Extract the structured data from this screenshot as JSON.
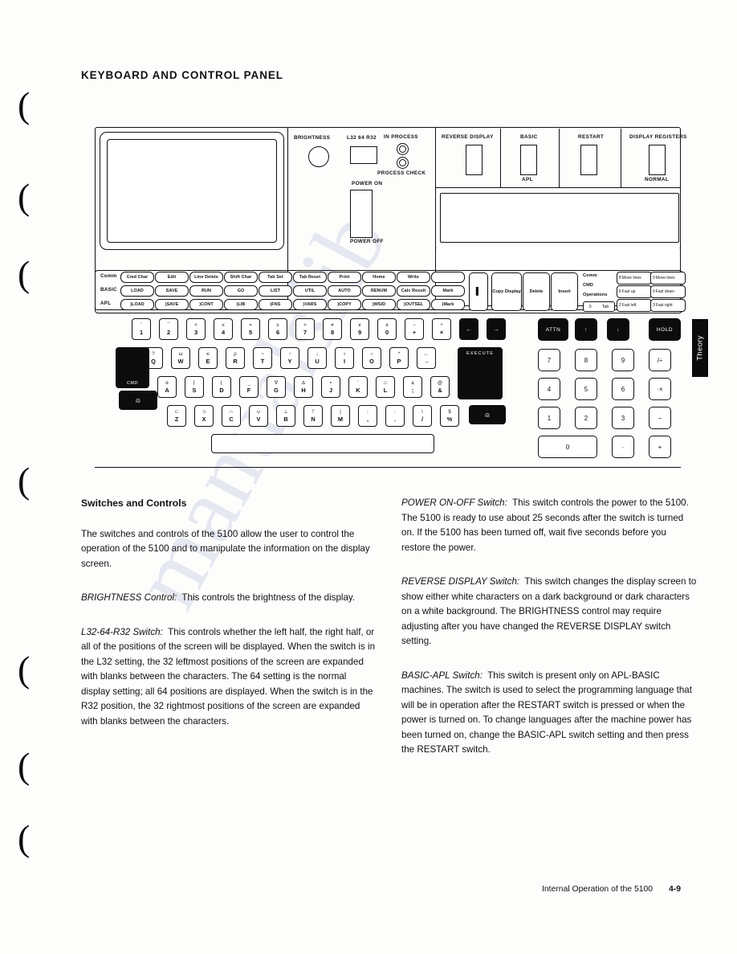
{
  "header": {
    "title": "KEYBOARD AND CONTROL PANEL"
  },
  "tab": {
    "label": "Theory"
  },
  "figure": {
    "control_panel": {
      "brightness_label": "BRIGHTNESS",
      "l32_label": "L32 64 R32",
      "in_process_label": "IN PROCESS",
      "process_check_label": "PROCESS CHECK",
      "power_on_label": "POWER ON",
      "power_off_label": "POWER OFF"
    },
    "switches": [
      {
        "top": "REVERSE DISPLAY",
        "bottom": ""
      },
      {
        "top": "BASIC",
        "bottom": "APL"
      },
      {
        "top": "RESTART",
        "bottom": ""
      },
      {
        "top": "DISPLAY REGISTERS",
        "bottom": "NORMAL"
      }
    ],
    "function_rows": [
      {
        "label": "Comm",
        "keys": [
          "Cmd Char",
          "Edit",
          "Line Delete",
          "Shift Char",
          "Tab Set",
          "Tab Reset",
          "Print",
          "Home",
          "Write",
          ""
        ]
      },
      {
        "label": "BASIC",
        "keys": [
          "LOAD",
          "SAVE",
          "RUN",
          "GO",
          "LIST",
          "UTIL",
          "AUTO",
          "RENUM",
          "Calc Result",
          "Mark"
        ]
      },
      {
        "label": "APL",
        "keys": [
          ")LOAD",
          ")SAVE",
          ")CONT",
          ")LIB",
          ")FNS",
          ")VARS",
          ")COPY",
          ")WSID",
          ")OUTSEL",
          ")Mark"
        ]
      }
    ],
    "edit_keys": [
      "Copy Display",
      "Delete",
      "Insert"
    ],
    "cmd_operations": {
      "title_lines": [
        "Comm",
        "CMD",
        "Operations"
      ],
      "tab_key": {
        "digit": "0",
        "label": "Tab"
      },
      "moves": [
        {
          "digit": "8",
          "label": "Move lines"
        },
        {
          "digit": "9",
          "label": "Move lines"
        },
        {
          "digit": "5",
          "label": "Fast up"
        },
        {
          "digit": "6",
          "label": "Fast down"
        },
        {
          "digit": "2",
          "label": "Fast left"
        },
        {
          "digit": "3",
          "label": "Fast right"
        }
      ]
    },
    "number_row": [
      {
        "upper": "¨",
        "lower": "1"
      },
      {
        "upper": "¯",
        "lower": "2"
      },
      {
        "upper": "<",
        "lower": "3"
      },
      {
        "upper": "≤",
        "lower": "4"
      },
      {
        "upper": "=",
        "lower": "5"
      },
      {
        "upper": "≥",
        "lower": "6"
      },
      {
        "upper": ">",
        "lower": "7"
      },
      {
        "upper": "≠",
        "lower": "8"
      },
      {
        "upper": "∨",
        "lower": "9"
      },
      {
        "upper": "∧",
        "lower": "0"
      },
      {
        "upper": "−",
        "lower": "+"
      },
      {
        "upper": "÷",
        "lower": "×"
      }
    ],
    "q_row": [
      {
        "upper": "?",
        "lower": "Q"
      },
      {
        "upper": "ω",
        "lower": "W"
      },
      {
        "upper": "∊",
        "lower": "E"
      },
      {
        "upper": "ρ",
        "lower": "R"
      },
      {
        "upper": "~",
        "lower": "T"
      },
      {
        "upper": "↑",
        "lower": "Y"
      },
      {
        "upper": "↓",
        "lower": "U"
      },
      {
        "upper": "ι",
        "lower": "I"
      },
      {
        "upper": "○",
        "lower": "O"
      },
      {
        "upper": "*",
        "lower": "P"
      },
      {
        "upper": "←",
        "lower": "→"
      }
    ],
    "a_row": [
      {
        "upper": "α",
        "lower": "A"
      },
      {
        "upper": "⌈",
        "lower": "S"
      },
      {
        "upper": "⌊",
        "lower": "D"
      },
      {
        "upper": "_",
        "lower": "F"
      },
      {
        "upper": "∇",
        "lower": "G"
      },
      {
        "upper": "∆",
        "lower": "H"
      },
      {
        "upper": "∘",
        "lower": "J"
      },
      {
        "upper": "'",
        "lower": "K"
      },
      {
        "upper": "□",
        "lower": "L"
      },
      {
        "upper": "⍎",
        "lower": ";"
      },
      {
        "upper": "@",
        "lower": "&"
      }
    ],
    "z_row": [
      {
        "upper": "⊂",
        "lower": "Z"
      },
      {
        "upper": "⊃",
        "lower": "X"
      },
      {
        "upper": "∩",
        "lower": "C"
      },
      {
        "upper": "∪",
        "lower": "V"
      },
      {
        "upper": "⊥",
        "lower": "B"
      },
      {
        "upper": "⊤",
        "lower": "N"
      },
      {
        "upper": "|",
        "lower": "M"
      },
      {
        "upper": ";",
        "lower": ","
      },
      {
        "upper": ":",
        "lower": "."
      },
      {
        "upper": "\\",
        "lower": "/"
      },
      {
        "upper": "$",
        "lower": "%"
      }
    ],
    "special_keys": {
      "cmd": "CMD",
      "execute": "EXECUTE",
      "attn": "ATTN",
      "hold": "HOLD",
      "up_arrow": "↑",
      "down_arrow": "↓",
      "shift": "⇧"
    },
    "numeric_pad": [
      [
        "7",
        "8",
        "9",
        "/÷"
      ],
      [
        "4",
        "5",
        "6",
        "·×"
      ],
      [
        "1",
        "2",
        "3",
        "−"
      ],
      [
        "0",
        "·",
        "+"
      ]
    ]
  },
  "body": {
    "left": {
      "heading": "Switches and Controls",
      "paragraphs": [
        {
          "term": "",
          "text": "The switches and controls of the 5100 allow the user to control the operation of the 5100 and to manipulate the information on the display screen."
        },
        {
          "term": "BRIGHTNESS Control:",
          "text": "This controls the brightness of the display."
        },
        {
          "term": "L32-64-R32 Switch:",
          "text": "This controls whether the left half, the right half, or all of the positions of the screen will be displayed. When the switch is in the L32 setting, the 32 leftmost positions of the screen are expanded with blanks between the characters. The 64 setting is the normal display setting; all 64 positions are displayed. When the switch is in the R32 position, the 32 rightmost positions of the screen are expanded with blanks between the characters."
        }
      ]
    },
    "right": {
      "paragraphs": [
        {
          "term": "POWER ON-OFF Switch:",
          "text": "This switch controls the power to the 5100. The 5100 is ready to use about 25 seconds after the switch is turned on. If the 5100 has been turned off, wait five seconds before you restore the power."
        },
        {
          "term": "REVERSE DISPLAY Switch:",
          "text": "This switch changes the display screen to show either white characters on a dark background or dark characters on a white background. The BRIGHTNESS control may require adjusting after you have changed the REVERSE DISPLAY switch setting."
        },
        {
          "term": "BASIC-APL Switch:",
          "text": "This switch is present only on APL-BASIC machines. The switch is used to select the programming language that will be in operation after the RESTART switch is pressed or when the power is turned on. To change languages after the machine power has been turned on, change the BASIC-APL switch setting and then press the RESTART switch."
        }
      ]
    }
  },
  "footer": {
    "text": "Internal Operation of the 5100",
    "page": "4-9"
  },
  "watermark": {
    "text": "manualslib"
  }
}
